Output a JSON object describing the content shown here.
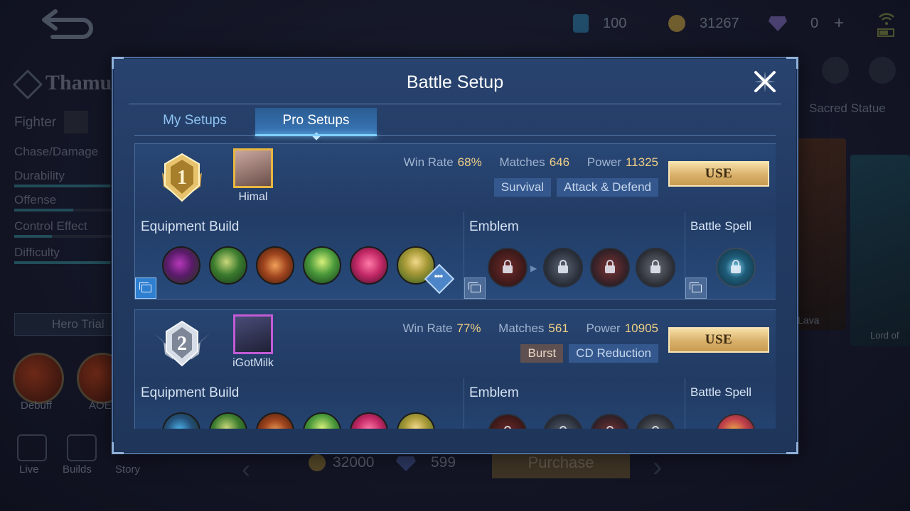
{
  "background": {
    "currencies": [
      {
        "icon": "ticket-icon",
        "value": "100"
      },
      {
        "icon": "gold-coin-icon",
        "value": "31267"
      },
      {
        "icon": "diamond-icon",
        "value": "0"
      }
    ],
    "hero_name": "Thamu",
    "role": "Fighter",
    "traits": [
      "Chase/Damage",
      "Durability",
      "Offense",
      "Control Effect",
      "Difficulty"
    ],
    "trait_levels": [
      0.0,
      0.9,
      0.55,
      0.35,
      0.9
    ],
    "hero_trial_label": "Hero Trial",
    "skills": [
      "Debuff",
      "AOE"
    ],
    "bottom_nav": [
      "Live",
      "Builds",
      "Story"
    ],
    "right_tab": "Sacred Statue",
    "card_labels": [
      "Lava",
      "Lord of"
    ],
    "price_gold": "32000",
    "price_diamond": "599",
    "purchase_label": "Purchase"
  },
  "modal": {
    "title": "Battle Setup",
    "tabs": [
      {
        "label": "My Setups",
        "active": false
      },
      {
        "label": "Pro Setups",
        "active": true
      }
    ],
    "labels": {
      "win_rate": "Win Rate",
      "matches": "Matches",
      "power": "Power",
      "equipment": "Equipment Build",
      "emblem": "Emblem",
      "battle_spell": "Battle Spell",
      "use": "USE"
    },
    "setups": [
      {
        "rank": "1",
        "player": "Himal",
        "win_rate": "68%",
        "matches": "646",
        "power": "11325",
        "tags": [
          "Survival",
          "Attack & Defend"
        ],
        "items": [
          "purple-boots-icon",
          "green-scythe-icon",
          "bronze-blade-icon",
          "green-claw-icon",
          "crimson-wings-icon",
          "gold-helm-icon"
        ],
        "emblems": [
          "red-emblem-icon",
          "grey-dash-emblem-icon",
          "red-swords-emblem-icon",
          "grey-shield-emblem-icon"
        ],
        "spell": "vengeance-spell-icon"
      },
      {
        "rank": "2",
        "player": "iGotMilk",
        "win_rate": "77%",
        "matches": "561",
        "power": "10905",
        "tags": [
          "Burst",
          "CD Reduction"
        ],
        "items": [
          "blue-boots-icon",
          "green-scythe-icon",
          "bronze-blade-icon",
          "green-claw-icon",
          "crimson-wings-icon",
          "gold-helm-icon"
        ],
        "emblems": [
          "red-emblem-icon",
          "grey-dash-emblem-icon",
          "red-swords-emblem-icon",
          "grey-shield-emblem-icon"
        ],
        "spell": "execute-spell-icon"
      }
    ]
  }
}
